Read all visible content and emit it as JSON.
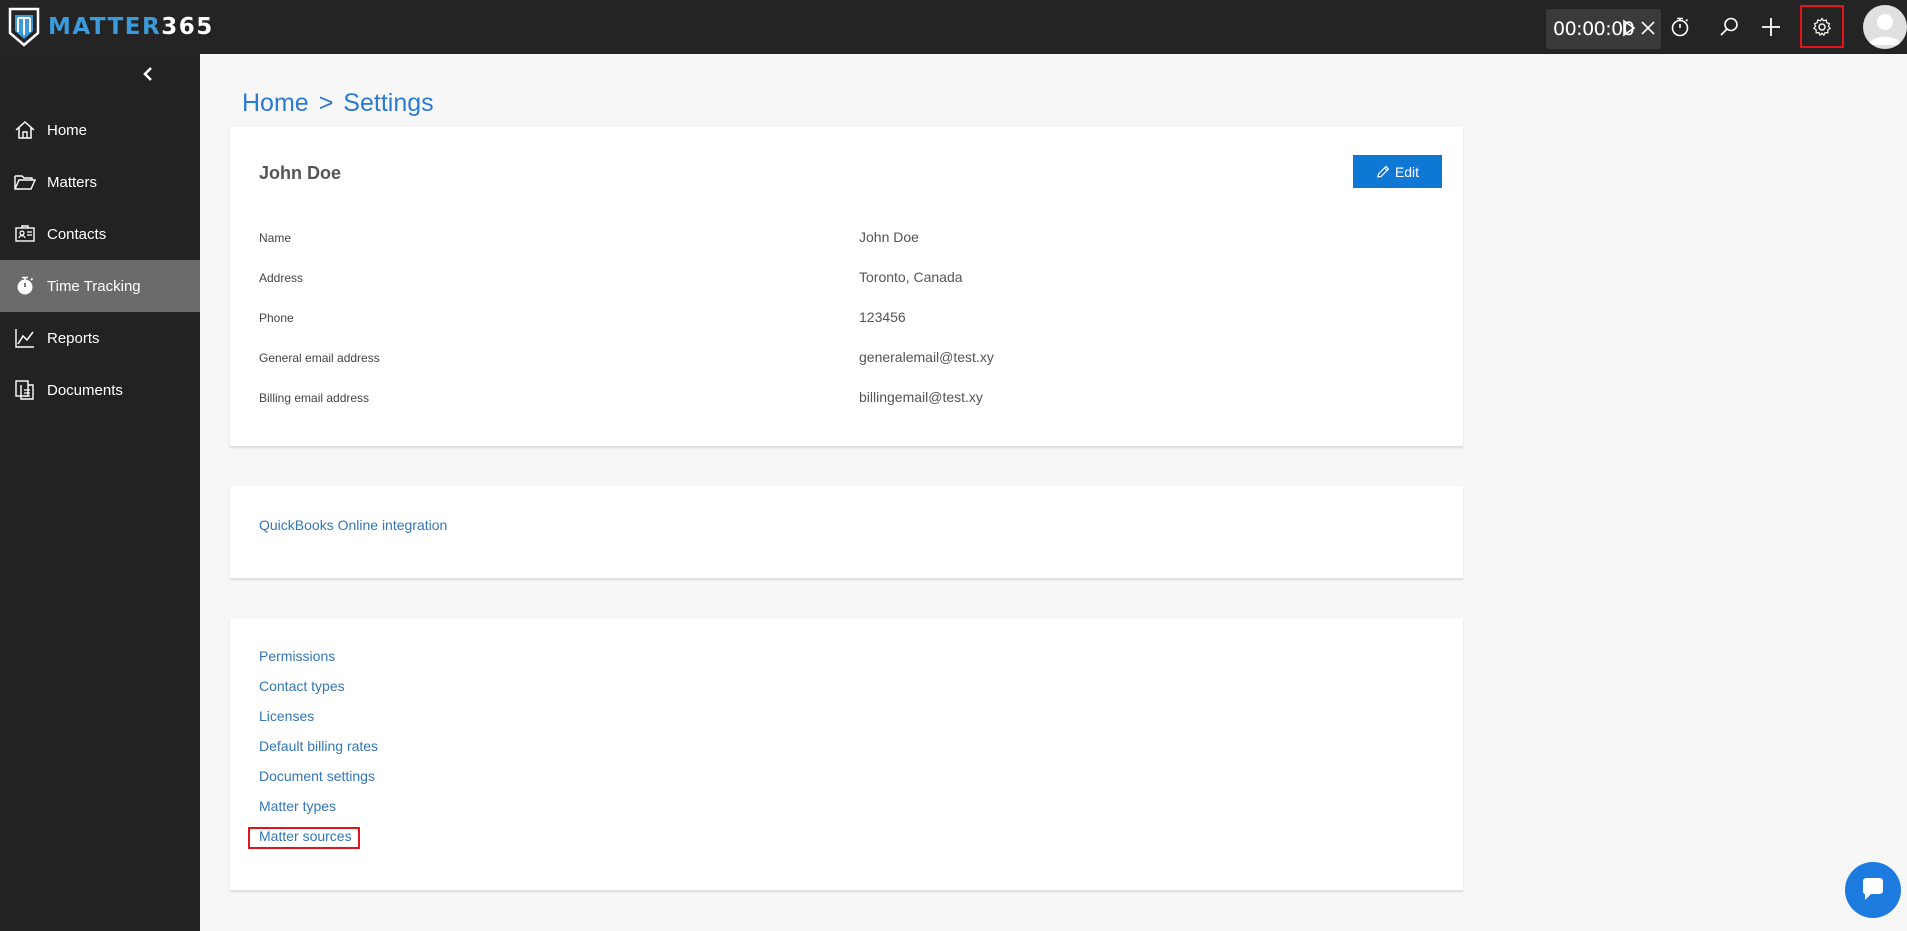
{
  "app": {
    "logo_part1": "MATTER",
    "logo_part2": "365"
  },
  "topbar": {
    "timer": "00:00:00",
    "icons": [
      "stopwatch-icon",
      "search-icon",
      "plus-icon",
      "gear-icon",
      "user-avatar"
    ]
  },
  "sidebar": {
    "items": [
      {
        "label": "Home",
        "icon": "home-icon"
      },
      {
        "label": "Matters",
        "icon": "folder-icon"
      },
      {
        "label": "Contacts",
        "icon": "contacts-icon"
      },
      {
        "label": "Time Tracking",
        "icon": "stopwatch-icon",
        "active": true
      },
      {
        "label": "Reports",
        "icon": "chart-icon"
      },
      {
        "label": "Documents",
        "icon": "documents-icon"
      }
    ]
  },
  "breadcrumb": {
    "home": "Home",
    "separator": ">",
    "current": "Settings"
  },
  "profile": {
    "name": "John Doe",
    "edit_label": "Edit",
    "fields": [
      {
        "label": "Name",
        "value": "John Doe"
      },
      {
        "label": "Address",
        "value": "Toronto, Canada"
      },
      {
        "label": "Phone",
        "value": "123456"
      },
      {
        "label": "General email address",
        "value": "generalemail@test.xy"
      },
      {
        "label": "Billing email address",
        "value": "billingemail@test.xy"
      }
    ]
  },
  "integrations": {
    "quickbooks": "QuickBooks Online integration"
  },
  "settings_links": [
    "Permissions",
    "Contact types",
    "Licenses",
    "Default billing rates",
    "Document settings",
    "Matter types",
    "Matter sources"
  ],
  "colors": {
    "accent": "#0f78d4",
    "link": "#3476b6",
    "highlight": "#e3151a",
    "sidebar": "#222222",
    "topbar": "#242424"
  }
}
